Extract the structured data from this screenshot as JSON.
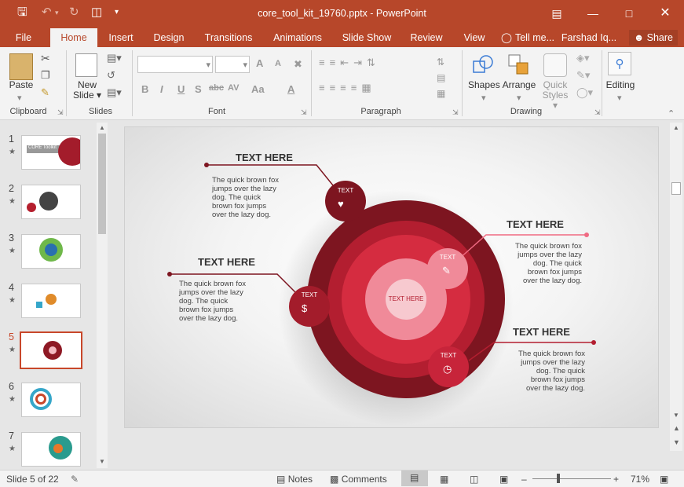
{
  "window": {
    "title": "core_tool_kit_19760.pptx - PowerPoint",
    "controls": [
      "restore-ribbon-icon",
      "minimize-icon",
      "maximize-icon",
      "close-icon"
    ]
  },
  "quick_access": {
    "save_icon": "save-icon",
    "undo_icon": "undo-icon",
    "redo_icon": "redo-icon",
    "present_icon": "present-icon",
    "customize_icon": "customize-icon"
  },
  "tabs": {
    "file": "File",
    "home": "Home",
    "insert": "Insert",
    "design": "Design",
    "transitions": "Transitions",
    "animations": "Animations",
    "slideshow": "Slide Show",
    "review": "Review",
    "view": "View",
    "tellme": "Tell me...",
    "user": "Farshad Iq...",
    "share": "Share"
  },
  "ribbon": {
    "clipboard": {
      "label": "Clipboard",
      "paste": "Paste"
    },
    "slides": {
      "label": "Slides",
      "new_slide_line1": "New",
      "new_slide_line2": "Slide"
    },
    "font": {
      "label": "Font",
      "font_name": "",
      "font_size": "",
      "bold": "B",
      "italic": "I",
      "underline": "U",
      "shadow": "S",
      "strike": "abc",
      "spacing": "AV",
      "case": "Aa",
      "grow": "A",
      "shrink": "A"
    },
    "paragraph": {
      "label": "Paragraph"
    },
    "drawing": {
      "label": "Drawing",
      "shapes": "Shapes",
      "arrange": "Arrange",
      "quick_line1": "Quick",
      "quick_line2": "Styles"
    },
    "editing": {
      "label": "Editing"
    }
  },
  "slides_panel": {
    "numbers": [
      "1",
      "2",
      "3",
      "4",
      "5",
      "6",
      "7"
    ],
    "selected": 5
  },
  "slide": {
    "top_left": {
      "heading": "TEXT HERE",
      "l1": "The quick brown fox",
      "l2": "jumps over the lazy",
      "l3": "dog. The quick",
      "l4": "brown fox jumps",
      "l5": "over the lazy dog."
    },
    "mid_left": {
      "heading": "TEXT HERE",
      "l1": "The quick brown fox",
      "l2": "jumps over the lazy",
      "l3": "dog. The quick",
      "l4": "brown fox jumps",
      "l5": "over the lazy dog."
    },
    "top_right": {
      "heading": "TEXT HERE",
      "l1": "The quick brown fox",
      "l2": "jumps over the lazy",
      "l3": "dog. The quick",
      "l4": "brown fox jumps",
      "l5": "over the lazy dog."
    },
    "bottom_right": {
      "heading": "TEXT HERE",
      "l1": "The quick brown fox",
      "l2": "jumps over the lazy",
      "l3": "dog. The quick",
      "l4": "brown fox jumps",
      "l5": "over the lazy dog."
    },
    "center": "TEXT HERE",
    "node_label": "TEXT",
    "colors": {
      "outer": "#7d1520",
      "ring2": "#b31e30",
      "ring3": "#d52c40",
      "ring4": "#f08a99",
      "core": "#f7c9cf",
      "line": "#7d1520",
      "pink": "#f06a82"
    }
  },
  "status": {
    "slide_of": "Slide 5 of 22",
    "notes": "Notes",
    "comments": "Comments",
    "zoom": "71%"
  },
  "thumb1_text": "CORE Toolkit"
}
